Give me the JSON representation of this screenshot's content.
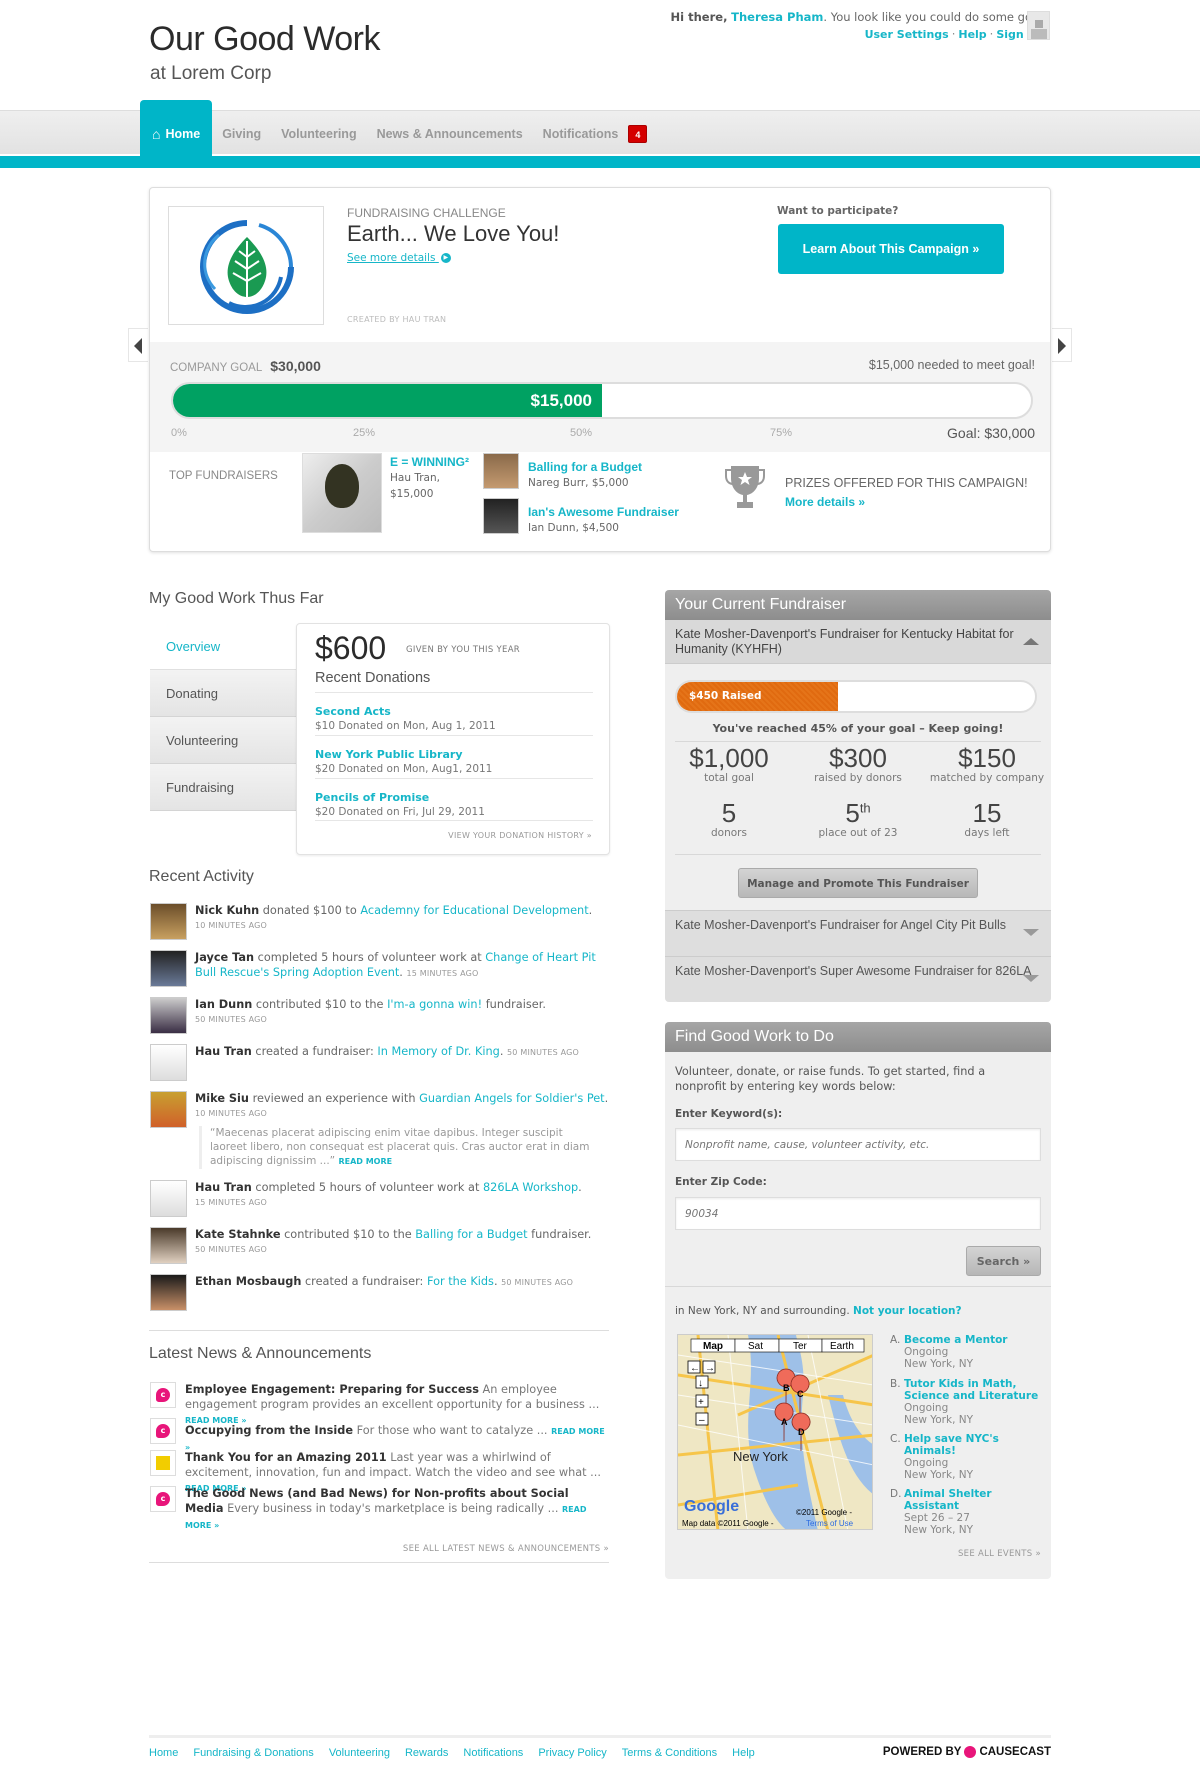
{
  "header": {
    "title": "Our Good Work",
    "subtitle": "at Lorem Corp",
    "greeting_prefix": "Hi there,",
    "user_name": "Theresa Pham",
    "greeting_suffix": ". You look like you could do some good.",
    "links": [
      "User Settings",
      "Help",
      "Sign Out"
    ]
  },
  "nav": {
    "items": [
      {
        "label": "Home",
        "active": true
      },
      {
        "label": "Giving"
      },
      {
        "label": "Volunteering"
      },
      {
        "label": "News & Announcements"
      },
      {
        "label": "Notifications",
        "badge": "4"
      }
    ]
  },
  "campaign": {
    "kicker": "FUNDRAISING CHALLENGE",
    "title": "Earth... We Love You!",
    "see_more": "See more details",
    "created_by": "CREATED BY HAU TRAN",
    "want_participate": "Want to participate?",
    "cta": "Learn About This Campaign »",
    "company_goal_label": "COMPANY GOAL",
    "company_goal": "$30,000",
    "needed": "$15,000 needed to meet goal!",
    "raised": "$15,000",
    "progress_percent": 50,
    "ticks": [
      "0%",
      "25%",
      "50%",
      "75%"
    ],
    "goal_final": "Goal: $30,000",
    "top_fundraisers_label": "TOP FUNDRAISERS",
    "top_fundraisers": [
      {
        "title": "E = WINNING²",
        "name": "Hau Tran,",
        "amount": "$15,000"
      },
      {
        "title": "Balling for a Budget",
        "detail": "Nareg Burr, $5,000"
      },
      {
        "title": "Ian's Awesome Fundraiser",
        "detail": "Ian Dunn, $4,500"
      }
    ],
    "prizes_title": "PRIZES OFFERED FOR THIS CAMPAIGN!",
    "prizes_more": "More details »"
  },
  "good_work": {
    "heading": "My Good Work Thus Far",
    "tabs": [
      "Overview",
      "Donating",
      "Volunteering",
      "Fundraising"
    ],
    "amount": "$600",
    "amount_label": "GIVEN BY YOU THIS YEAR",
    "recent_heading": "Recent Donations",
    "donations": [
      {
        "name": "Second Acts",
        "detail": "$10 Donated on Mon, Aug 1, 2011"
      },
      {
        "name": "New York Public Library",
        "detail": "$20 Donated on Mon, Aug1, 2011"
      },
      {
        "name": "Pencils of Promise",
        "detail": "$20 Donated on Fri, Jul 29, 2011"
      }
    ],
    "history_link": "VIEW YOUR DONATION HISTORY »"
  },
  "activity": {
    "heading": "Recent Activity",
    "items": [
      {
        "actor": "Nick Kuhn",
        "verb": " donated $100 to ",
        "link": "Academny for Educational Development",
        "after": ".",
        "time": "10 MINUTES AGO"
      },
      {
        "actor": "Jayce Tan",
        "verb": " completed 5 hours of volunteer work at ",
        "link": "Change of Heart Pit Bull Rescue's Spring Adoption Event",
        "after": ". ",
        "time": "15 MINUTES AGO"
      },
      {
        "actor": "Ian Dunn",
        "verb": " contributed $10 to the ",
        "link": "I'm-a gonna win!",
        "after": " fundraiser.",
        "time": "50 MINUTES AGO"
      },
      {
        "actor": "Hau Tran",
        "verb": " created a fundraiser: ",
        "link": "In Memory of Dr. King",
        "after": ". ",
        "time": "50 MINUTES AGO"
      },
      {
        "actor": "Mike Siu",
        "verb": " reviewed an experience with ",
        "link": "Guardian Angels for Soldier's Pet",
        "after": ".",
        "time": "10 MINUTES AGO"
      },
      {
        "actor": "Hau Tran",
        "verb": " completed 5 hours of volunteer work at ",
        "link": "826LA Workshop",
        "after": ".",
        "time": "15 MINUTES AGO"
      },
      {
        "actor": "Kate Stahnke",
        "verb": " contributed $10 to the ",
        "link": "Balling for a Budget",
        "after": " fundraiser.",
        "time": "50 MINUTES AGO"
      },
      {
        "actor": "Ethan Mosbaugh",
        "verb": " created a fundraiser: ",
        "link": "For the Kids",
        "after": ". ",
        "time": "50 MINUTES AGO"
      }
    ],
    "quote": "“Maecenas placerat adipiscing enim vitae dapibus. Integer suscipit laoreet libero, non consequat est placerat quis. Cras auctor erat in diam adipiscing dignissim ...”",
    "quote_more": "READ MORE"
  },
  "news": {
    "heading": "Latest News & Announcements",
    "items": [
      {
        "title": "Employee Engagement: Preparing for Success",
        "text": " An employee engagement program provides an excellent opportunity for a business ... ",
        "icon": "causecast"
      },
      {
        "title": "Occupying from the Inside",
        "text": " For those who want to catalyze ... ",
        "icon": "causecast"
      },
      {
        "title": "Thank You for an Amazing 2011",
        "text": " Last year was a whirlwind of excitement, innovation, fun and impact. Watch the video and see what ... ",
        "icon": "yellow"
      },
      {
        "title": "The Good News (and Bad News) for Non-profits about Social Media",
        "text": " Every business in today's marketplace is being radically ... ",
        "icon": "causecast"
      }
    ],
    "read_more": "READ MORE »",
    "see_all": "SEE ALL LATEST NEWS & ANNOUNCEMENTS »"
  },
  "fundraiser": {
    "heading": "Your Current Fundraiser",
    "open_title": "Kate Mosher-Davenport's Fundraiser for Kentucky Habitat for Humanity (KYHFH)",
    "raised_label": "$450 Raised",
    "progress_percent": 45,
    "reached": "You've reached 45% of your goal – Keep going!",
    "stats": [
      {
        "value": "$1,000",
        "label": "total goal"
      },
      {
        "value": "$300",
        "label": "raised by donors"
      },
      {
        "value": "$150",
        "label": "matched by company"
      },
      {
        "value": "5",
        "label": "donors"
      },
      {
        "value": "5",
        "sup": "th",
        "label": "place out of 23"
      },
      {
        "value": "15",
        "label": "days left"
      }
    ],
    "manage_button": "Manage and Promote This Fundraiser",
    "others": [
      "Kate Mosher-Davenport's Fundraiser for Angel City Pit Bulls",
      "Kate Mosher-Davenport's Super Awesome Fundraiser for 826LA"
    ]
  },
  "find": {
    "heading": "Find Good Work to Do",
    "desc": "Volunteer, donate, or raise funds. To get started, find a nonprofit by entering key words below:",
    "keyword_label": "Enter Keyword(s):",
    "keyword_placeholder": "Nonprofit name, cause, volunteer activity, etc.",
    "zip_label": "Enter Zip Code:",
    "zip_placeholder": "90034",
    "search_button": "Search »",
    "location_text": "in New York, NY and surrounding. ",
    "location_link": "Not your location?",
    "map_buttons": [
      "Map",
      "Sat",
      "Ter",
      "Earth"
    ],
    "map_city": "New York",
    "map_copyright": "©2011 Google -",
    "map_data": "Map data ©2011 Google - ",
    "map_terms": "Terms of Use",
    "events": [
      {
        "letter": "A.",
        "title": "Become a Mentor",
        "when": "Ongoing",
        "where": "New York, NY"
      },
      {
        "letter": "B.",
        "title": "Tutor Kids in Math, Science and Literature",
        "when": "Ongoing",
        "where": "New York, NY"
      },
      {
        "letter": "C.",
        "title": "Help save NYC's Animals!",
        "when": "Ongoing",
        "where": "New York, NY"
      },
      {
        "letter": "D.",
        "title": "Animal Shelter Assistant",
        "when": "Sept 26 – 27",
        "where": "New York, NY"
      }
    ],
    "see_all": "SEE ALL EVENTS »"
  },
  "footer": {
    "links": [
      "Home",
      "Fundraising & Donations",
      "Volunteering",
      "Rewards",
      "Notifications",
      "Privacy Policy",
      "Terms & Conditions",
      "Help"
    ],
    "powered_by": "POWERED BY",
    "brand": "CAUSECAST"
  },
  "colors": {
    "accent": "#00b5c8",
    "goal_green": "#00a162",
    "fundraiser_orange": "#e06a10",
    "badge_red": "#d40000"
  }
}
